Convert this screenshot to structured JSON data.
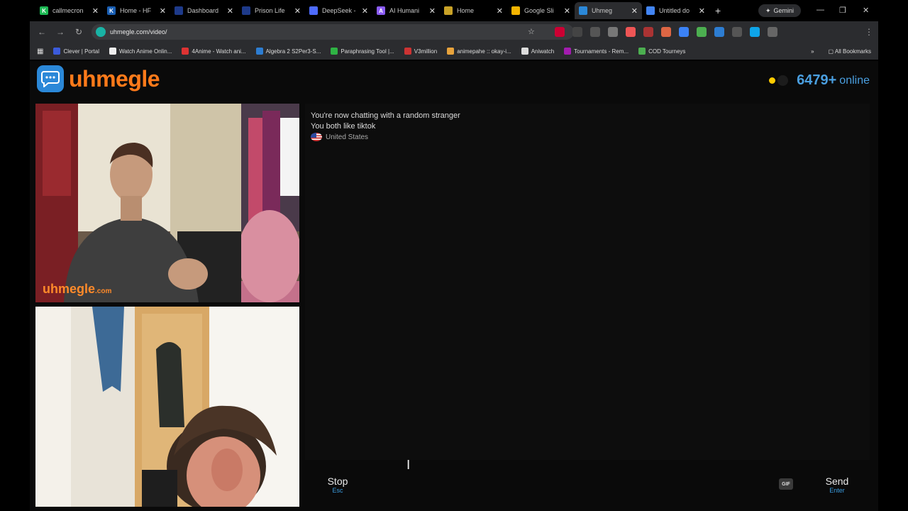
{
  "browser": {
    "tabs": [
      {
        "title": "callmecron",
        "color": "#1db954",
        "glyph": "K"
      },
      {
        "title": "Home - HF",
        "color": "#1a5fb4",
        "glyph": "K"
      },
      {
        "title": "Dashboard",
        "color": "#1e3a8a",
        "glyph": ""
      },
      {
        "title": "Prison Life",
        "color": "#1e3a8a",
        "glyph": ""
      },
      {
        "title": "DeepSeek -",
        "color": "#4d6bfe",
        "glyph": ""
      },
      {
        "title": "AI Humani",
        "color": "#8b5cf6",
        "glyph": "A"
      },
      {
        "title": "Home",
        "color": "#c9a227",
        "glyph": ""
      },
      {
        "title": "Google Sli",
        "color": "#f4b400",
        "glyph": ""
      },
      {
        "title": "Uhmeg",
        "color": "#2b88d8",
        "glyph": ""
      },
      {
        "title": "Untitled do",
        "color": "#4285f4",
        "glyph": ""
      }
    ],
    "active_tab": 8,
    "new_tab": "+",
    "gemini_label": "Gemini",
    "url": "uhmegle.com/video/",
    "extension_colors": [
      "#c03",
      "#444",
      "#555",
      "#777",
      "#e55",
      "#a33",
      "#d64",
      "#3b82f6",
      "#4caf50",
      "#2d7dd2",
      "#555",
      "#0ea5e9",
      "#666"
    ],
    "bookmarks": [
      {
        "label": "Clever | Portal",
        "color": "#3b5bdb"
      },
      {
        "label": "Watch Anime Onlin...",
        "color": "#eee"
      },
      {
        "label": "4Anime - Watch ani...",
        "color": "#d33"
      },
      {
        "label": "Algebra 2 S2Per3-S...",
        "color": "#2d7dd2"
      },
      {
        "label": "Paraphrasing Tool |...",
        "color": "#2fb344"
      },
      {
        "label": "V3million",
        "color": "#c33"
      },
      {
        "label": "animepahe :: okay-i...",
        "color": "#e8a33c"
      },
      {
        "label": "Aniwatch",
        "color": "#ddd"
      },
      {
        "label": "Tournaments - Rem...",
        "color": "#a21caf"
      },
      {
        "label": "COD Tourneys",
        "color": "#4caf50"
      }
    ],
    "all_bookmarks": "All Bookmarks"
  },
  "site": {
    "logo_text": "uhmegle",
    "online_count": "6479+",
    "online_label": "online",
    "watermark_main": "uhmegle",
    "watermark_suffix": ".com"
  },
  "chat": {
    "messages": [
      "You're now chatting with a random stranger",
      "You both like tiktok"
    ],
    "country": "United States"
  },
  "controls": {
    "stop_label": "Stop",
    "stop_hint": "Esc",
    "gif_label": "GIF",
    "send_label": "Send",
    "send_hint": "Enter",
    "input_value": ""
  }
}
